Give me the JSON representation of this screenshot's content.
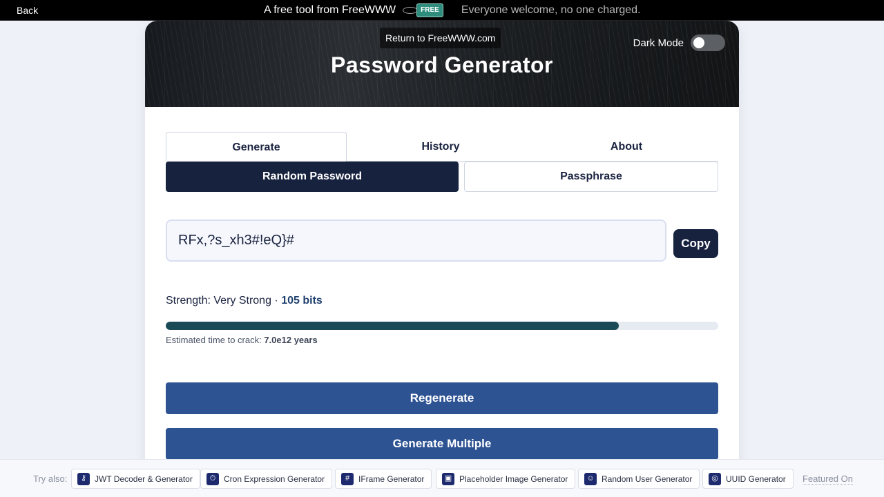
{
  "topbar": {
    "back": "Back",
    "promo": "A free tool from FreeWWW",
    "free_tag": "FREE",
    "promo_sub": "Everyone welcome, no one charged."
  },
  "hero": {
    "return_link": "Return to FreeWWW.com",
    "title": "Password Generator",
    "dark_mode_label": "Dark Mode",
    "dark_mode_on": false
  },
  "tabs": [
    {
      "label": "Generate",
      "active": true
    },
    {
      "label": "History",
      "active": false
    },
    {
      "label": "About",
      "active": false
    }
  ],
  "mode": {
    "random": "Random Password",
    "passphrase": "Passphrase",
    "selected": "random"
  },
  "password": {
    "value": "RFx,?s_xh3#!eQ}#",
    "copy_label": "Copy"
  },
  "strength": {
    "label": "Strength: Very Strong · ",
    "bits": "105 bits",
    "fill_percent": 82,
    "crack_label": "Estimated time to crack: ",
    "crack_value": "7.0e12 years"
  },
  "actions": {
    "regenerate": "Regenerate",
    "generate_multiple": "Generate Multiple"
  },
  "bottombar": {
    "try_label": "Try also:",
    "tools": [
      {
        "label": "JWT Decoder & Generator",
        "icon": "key-icon"
      },
      {
        "label": "Cron Expression Generator",
        "icon": "timer-icon"
      },
      {
        "label": "IFrame Generator",
        "icon": "hash-icon"
      },
      {
        "label": "Placeholder Image Generator",
        "icon": "image-icon"
      },
      {
        "label": "Random User Generator",
        "icon": "user-icon"
      },
      {
        "label": "UUID Generator",
        "icon": "fingerprint-icon"
      }
    ],
    "featured": "Featured On"
  },
  "colors": {
    "navy": "#17223f",
    "action_blue": "#2e5393",
    "strength_fill": "#1a4a55"
  }
}
